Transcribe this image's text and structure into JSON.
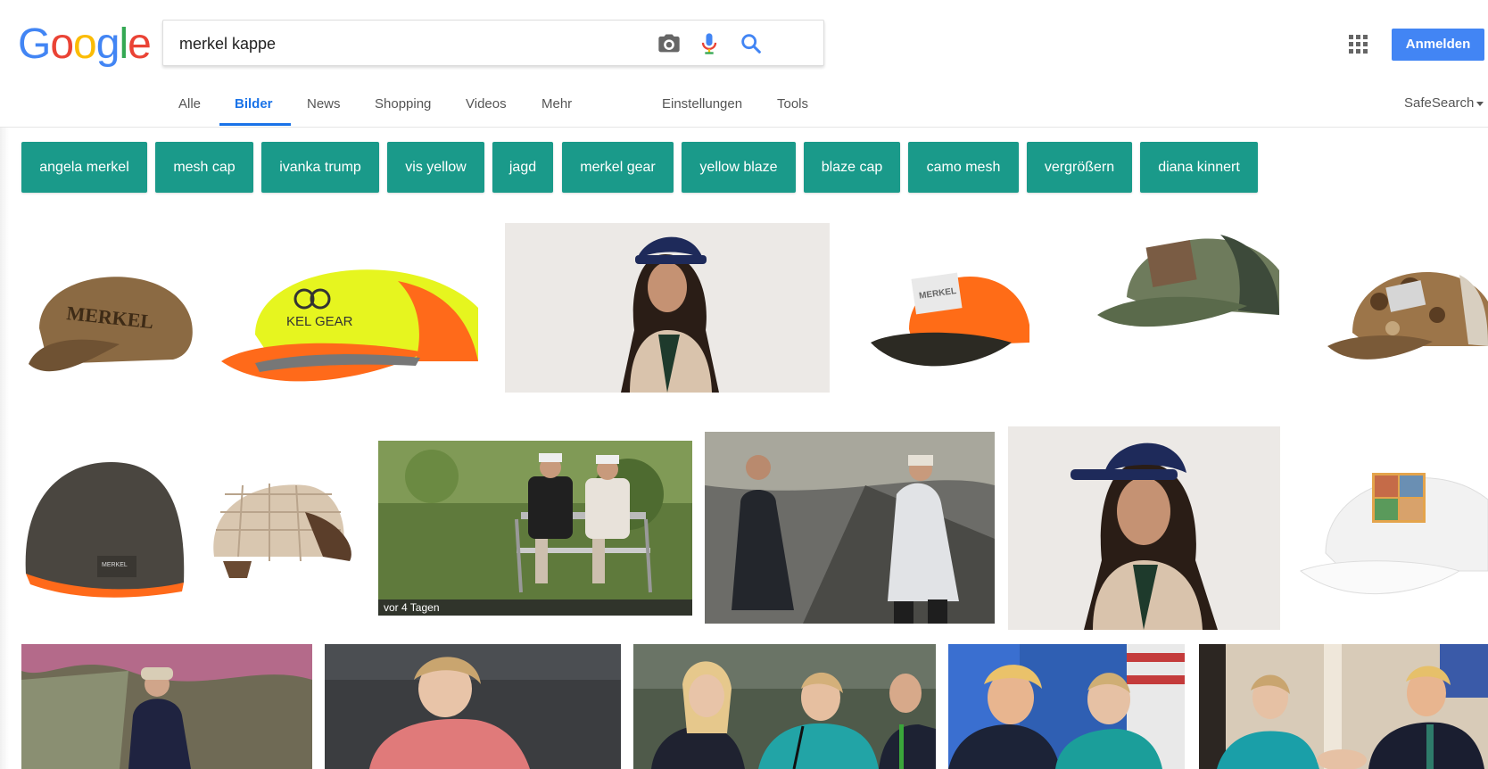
{
  "logo": "Google",
  "search": {
    "query": "merkel kappe"
  },
  "header": {
    "signin_label": "Anmelden"
  },
  "tabs": {
    "alle": "Alle",
    "bilder": "Bilder",
    "news": "News",
    "shopping": "Shopping",
    "videos": "Videos",
    "mehr": "Mehr",
    "einstellungen": "Einstellungen",
    "tools": "Tools",
    "safesearch": "SafeSearch"
  },
  "chips": [
    "angela merkel",
    "mesh cap",
    "ivanka trump",
    "vis yellow",
    "jagd",
    "merkel gear",
    "yellow blaze",
    "blaze cap",
    "camo mesh",
    "vergrößern",
    "diana kinnert"
  ],
  "results": {
    "badge_time": "vor 4 Tagen"
  },
  "colors": {
    "chip": "#1a9a8a",
    "primary": "#4285f4",
    "active_tab": "#1a73e8"
  }
}
